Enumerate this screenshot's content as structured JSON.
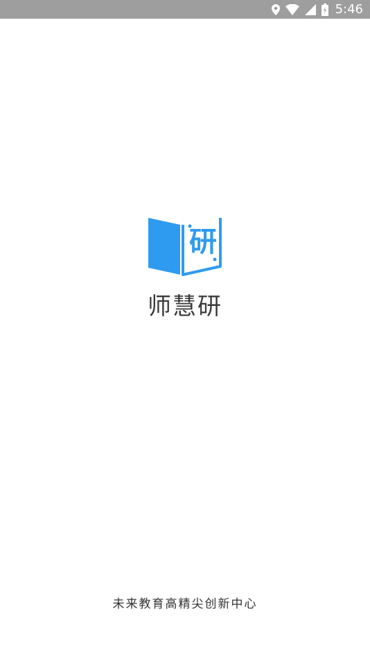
{
  "status_bar": {
    "time": "5:46",
    "icons": [
      "location-icon",
      "wifi-icon",
      "signal-icon",
      "battery-icon"
    ]
  },
  "splash": {
    "logo_icon": "book-logo-icon",
    "logo_glyph": "研",
    "app_name": "师慧研",
    "tagline": "未来教育高精尖创新中心"
  },
  "colors": {
    "status_bar_bg": "#9e9e9e",
    "brand_blue": "#2f9bf0",
    "text_dark": "#3a3a3a",
    "background": "#ffffff"
  }
}
